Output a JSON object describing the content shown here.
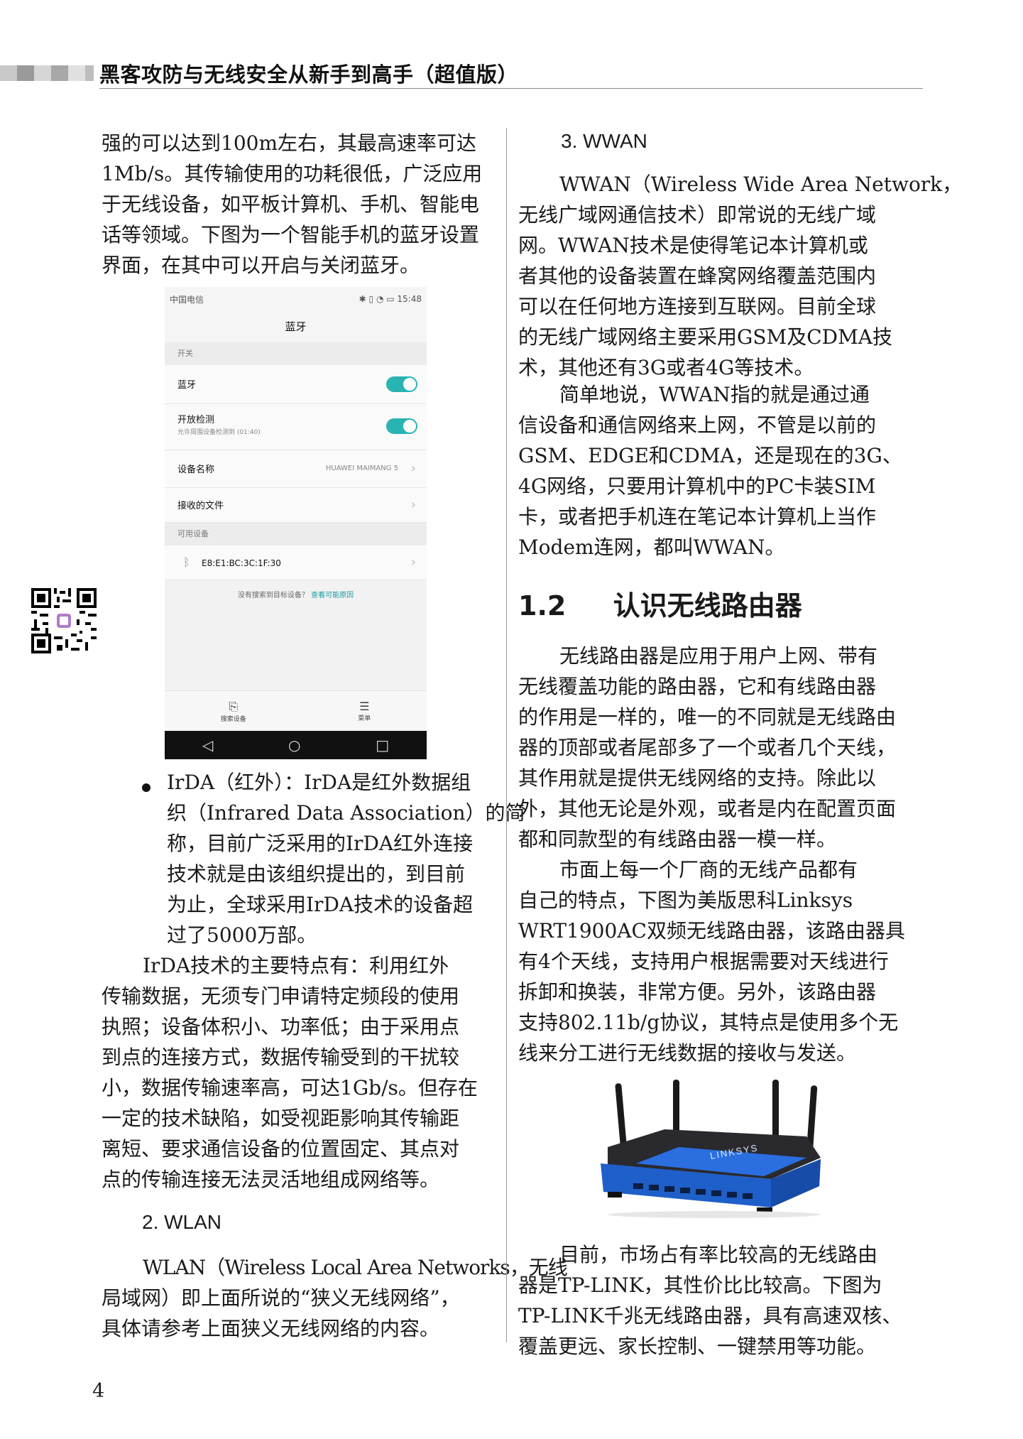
{
  "header": {
    "title": "黑客攻防与无线安全从新手到高手（超值版）"
  },
  "left_column": {
    "para1": [
      "强的可以达到100m左右，其最高速率可达",
      "1Mb/s。其传输使用的功耗很低，广泛应用",
      "于无线设备，如平板计算机、手机、智能电",
      "话等领域。下图为一个智能手机的蓝牙设置",
      "界面，在其中可以开启与关闭蓝牙。"
    ],
    "bullet": [
      "IrDA（红外）：IrDA是红外数据组",
      "织（Infrared Data Association）的简",
      "称，目前广泛采用的IrDA红外连接",
      "技术就是由该组织提出的，到目前",
      "为止，全球采用IrDA技术的设备超",
      "过了5000万部。"
    ],
    "para2": [
      "IrDA技术的主要特点有：利用红外",
      "传输数据，无须专门申请特定频段的使用",
      "执照；设备体积小、功率低；由于采用点",
      "到点的连接方式，数据传输受到的干扰较",
      "小，数据传输速率高，可达1Gb/s。但存在",
      "一定的技术缺陷，如受视距影响其传输距",
      "离短、要求通信设备的位置固定、其点对",
      "点的传输连接无法灵活地组成网络等。"
    ],
    "wlan_heading": "2. WLAN",
    "wlan_para": [
      "WLAN（Wireless Local Area Networks，无线",
      "局域网）即上面所说的“狭义无线网络”，",
      "具体请参考上面狭义无线网络的内容。"
    ]
  },
  "right_column": {
    "wwan_heading": "3. WWAN",
    "wwan_para1": [
      "WWAN（Wireless Wide Area Network，",
      "无线广域网通信技术）即常说的无线广域",
      "网。WWAN技术是使得笔记本计算机或",
      "者其他的设备装置在蜂窝网络覆盖范围内",
      "可以在任何地方连接到互联网。目前全球",
      "的无线广域网络主要采用GSM及CDMA技",
      "术，其他还有3G或者4G等技术。"
    ],
    "wwan_para2": [
      "简单地说，WWAN指的就是通过通",
      "信设备和通信网络来上网，不管是以前的",
      "GSM、EDGE和CDMA，还是现在的3G、",
      "4G网络，只要用计算机中的PC卡装SIM",
      "卡，或者把手机连在笔记本计算机上当作",
      "Modem连网，都叫WWAN。"
    ],
    "section_number": "1.2",
    "section_title": "认识无线路由器",
    "router_para1": [
      "无线路由器是应用于用户上网、带有",
      "无线覆盖功能的路由器，它和有线路由器",
      "的作用是一样的，唯一的不同就是无线路由",
      "器的顶部或者尾部多了一个或者几个天线，",
      "其作用就是提供无线网络的支持。除此以",
      "外，其他无论是外观，或者是内在配置页面",
      "都和同款型的有线路由器一模一样。"
    ],
    "router_para2": [
      "市面上每一个厂商的无线产品都有",
      "自己的特点，下图为美版思科Linksys",
      "WRT1900AC双频无线路由器，该路由器具",
      "有4个天线，支持用户根据需要对天线进行",
      "拆卸和换装，非常方便。另外，该路由器",
      "支持802.11b/g协议，其特点是使用多个无",
      "线来分工进行无线数据的接收与发送。"
    ],
    "router_brand": "LINKSYS",
    "router_para3": [
      "目前，市场占有率比较高的无线路由",
      "器是TP-LINK，其性价比比较高。下图为",
      "TP-LINK千兆无线路由器，具有高速双核、",
      "覆盖更远、家长控制、一键禁用等功能。"
    ]
  },
  "phone": {
    "carrier": "中国电信",
    "time": "15:48",
    "title": "蓝牙",
    "group_switch": "开关",
    "bluetooth_label": "蓝牙",
    "detect_label": "开放检测",
    "detect_sub": "允许周围设备检测到 (01:40)",
    "device_name_label": "设备名称",
    "device_name_value": "HUAWEI MAIMANG 5",
    "received_files": "接收的文件",
    "group_available": "可用设备",
    "device_mac": "E8:E1:BC:3C:1F:30",
    "not_found": "没有搜索到目标设备？",
    "not_found_link": "查看可能原因",
    "tab_search": "搜索设备",
    "tab_menu": "菜单"
  },
  "page_number": "4"
}
